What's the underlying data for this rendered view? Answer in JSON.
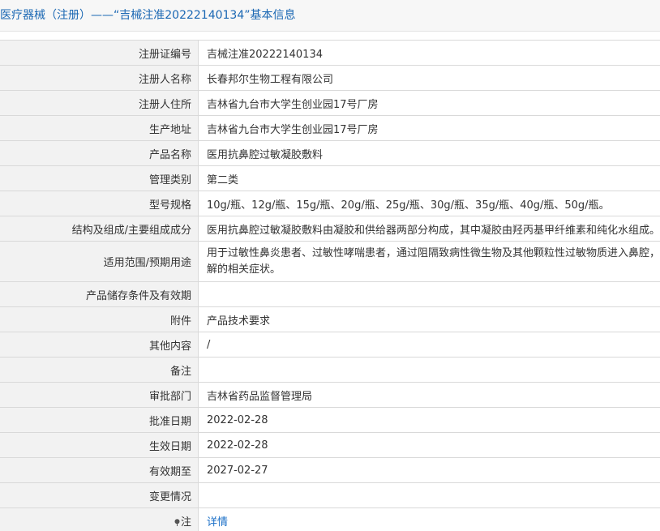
{
  "header": {
    "title": "医疗器械（注册）——“吉械注准20222140134”基本信息"
  },
  "rows": [
    {
      "label": "注册证编号",
      "value": "吉械注准20222140134"
    },
    {
      "label": "注册人名称",
      "value": "长春邦尔生物工程有限公司"
    },
    {
      "label": "注册人住所",
      "value": "吉林省九台市大学生创业园17号厂房"
    },
    {
      "label": "生产地址",
      "value": "吉林省九台市大学生创业园17号厂房"
    },
    {
      "label": "产品名称",
      "value": "医用抗鼻腔过敏凝胶敷料"
    },
    {
      "label": "管理类别",
      "value": "第二类"
    },
    {
      "label": "型号规格",
      "value": "10g/瓶、12g/瓶、15g/瓶、20g/瓶、25g/瓶、30g/瓶、35g/瓶、40g/瓶、50g/瓶。"
    },
    {
      "label": "结构及组成/主要组成成分",
      "value": "医用抗鼻腔过敏凝胶敷料由凝胶和供给器两部分构成，其中凝胶由羟丙基甲纤维素和纯化水组成。"
    },
    {
      "label": "适用范围/预期用途",
      "value": "用于过敏性鼻炎患者、过敏性哮喘患者，通过阻隔致病性微生物及其他颗粒性过敏物质进入鼻腔，缓解的相关症状。"
    },
    {
      "label": "产品储存条件及有效期",
      "value": ""
    },
    {
      "label": "附件",
      "value": "产品技术要求"
    },
    {
      "label": "其他内容",
      "value": "/"
    },
    {
      "label": "备注",
      "value": ""
    },
    {
      "label": "审批部门",
      "value": "吉林省药品监督管理局"
    },
    {
      "label": "批准日期",
      "value": "2022-02-28"
    },
    {
      "label": "生效日期",
      "value": "2022-02-28"
    },
    {
      "label": "有效期至",
      "value": "2027-02-27"
    },
    {
      "label": "变更情况",
      "value": ""
    }
  ],
  "note": {
    "label": "注",
    "link_text": "详情",
    "icon": "pin-icon"
  }
}
